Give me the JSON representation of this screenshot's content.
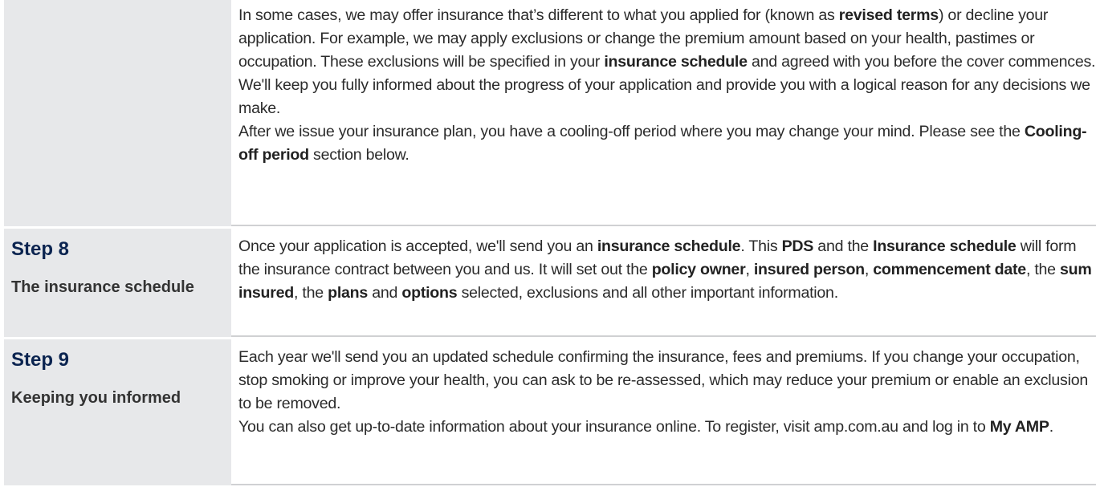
{
  "rows": [
    {
      "step": "",
      "title": "",
      "paragraphs": [
        [
          [
            "In some cases, we may offer insurance that’s different to what you applied for (known as ",
            0
          ],
          [
            "revised terms",
            1
          ],
          [
            ") or decline your application. For example, we may apply exclusions or change the premium amount based on your health, pastimes or occupation. These exclusions will be specified in your ",
            0
          ],
          [
            "insurance schedule",
            1
          ],
          [
            " and agreed with you before the cover commences.",
            0
          ]
        ],
        [
          [
            "We'll keep you fully informed about the progress of your application and provide you with a logical reason for any decisions we make.",
            0
          ]
        ],
        [
          [
            "After we issue your insurance plan, you have a cooling-off period where you may change your mind. Please see the ",
            0
          ],
          [
            "Cooling-off period",
            1
          ],
          [
            " section below.",
            0
          ]
        ]
      ]
    },
    {
      "step": "Step 8",
      "title": "The insurance schedule",
      "paragraphs": [
        [
          [
            "Once your application is accepted, we'll send you an ",
            0
          ],
          [
            "insurance schedule",
            1
          ],
          [
            ". This ",
            0
          ],
          [
            "PDS",
            1
          ],
          [
            " and the ",
            0
          ],
          [
            "Insurance schedule",
            1
          ],
          [
            " will form the insurance contract between you and us. It will set out the ",
            0
          ],
          [
            "policy owner",
            1
          ],
          [
            ", ",
            0
          ],
          [
            "insured person",
            1
          ],
          [
            ", ",
            0
          ],
          [
            "commencement date",
            1
          ],
          [
            ", the ",
            0
          ],
          [
            "sum insured",
            1
          ],
          [
            ", the ",
            0
          ],
          [
            "plans",
            1
          ],
          [
            " and ",
            0
          ],
          [
            "options",
            1
          ],
          [
            " selected, exclusions and all other important information.",
            0
          ]
        ]
      ]
    },
    {
      "step": "Step 9",
      "title": "Keeping you informed",
      "paragraphs": [
        [
          [
            "Each year we'll send you an updated schedule confirming the insurance, fees and premiums. If you change your occupation, stop smoking or improve your health, you can ask to be re-assessed, which may reduce your premium or enable an exclusion to be removed.",
            0
          ]
        ],
        [
          [
            "You can also get up-to-date information about your insurance online. To register, visit amp.com.au and log in to ",
            0
          ],
          [
            "My AMP",
            1
          ],
          [
            ".",
            0
          ]
        ]
      ]
    }
  ]
}
